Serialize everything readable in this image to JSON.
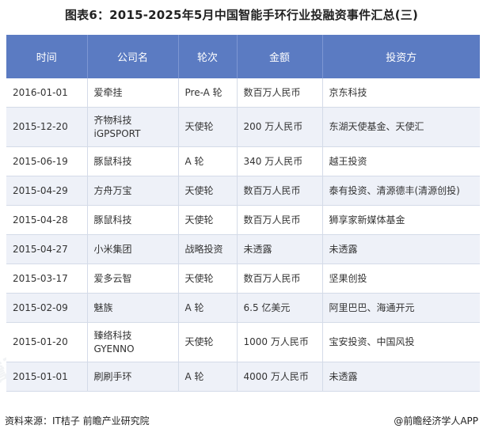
{
  "title": "图表6：2015-2025年5月中国智能手环行业投融资事件汇总(三)",
  "table": {
    "headers": [
      "时间",
      "公司名",
      "轮次",
      "金额",
      "投资方"
    ],
    "rows": [
      {
        "date": "2016-01-01",
        "company": [
          "爱牵挂"
        ],
        "round": "Pre-A 轮",
        "amount": "数百万人民币",
        "investor": "京东科技"
      },
      {
        "date": "2015-12-20",
        "company": [
          "齐物科技",
          "iGPSPORT"
        ],
        "round": "天使轮",
        "amount": "200 万人民币",
        "investor": "东湖天使基金、天使汇"
      },
      {
        "date": "2015-06-19",
        "company": [
          "豚鼠科技"
        ],
        "round": "A 轮",
        "amount": "340 万人民币",
        "investor": "越王投资"
      },
      {
        "date": "2015-04-29",
        "company": [
          "方舟万宝"
        ],
        "round": "天使轮",
        "amount": "数百万人民币",
        "investor": "泰有投资、清源德丰(清源创投)"
      },
      {
        "date": "2015-04-28",
        "company": [
          "豚鼠科技"
        ],
        "round": "天使轮",
        "amount": "数百万人民币",
        "investor": "狮享家新媒体基金"
      },
      {
        "date": "2015-04-27",
        "company": [
          "小米集团"
        ],
        "round": "战略投资",
        "amount": "未透露",
        "investor": "未透露"
      },
      {
        "date": "2015-03-17",
        "company": [
          "爱多云智"
        ],
        "round": "天使轮",
        "amount": "数百万人民币",
        "investor": "坚果创投"
      },
      {
        "date": "2015-02-09",
        "company": [
          "魅族"
        ],
        "round": "A 轮",
        "amount": "6.5 亿美元",
        "investor": "阿里巴巴、海通开元"
      },
      {
        "date": "2015-01-20",
        "company": [
          "臻络科技",
          "GYENNO"
        ],
        "round": "天使轮",
        "amount": "1000 万人民币",
        "investor": "宝安投资、中国风投"
      },
      {
        "date": "2015-01-01",
        "company": [
          "刷刷手环"
        ],
        "round": "A 轮",
        "amount": "4000 万人民币",
        "investor": "未透露"
      }
    ]
  },
  "source": "资料来源：IT桔子 前瞻产业研究院",
  "credit": "@前瞻经济学人APP",
  "watermark": "前瞻产业研究院"
}
